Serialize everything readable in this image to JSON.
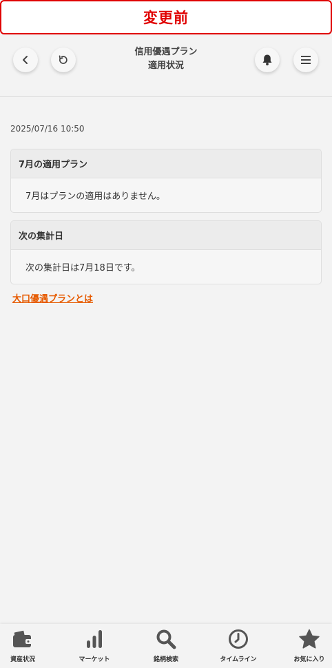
{
  "banner": {
    "text": "変更前"
  },
  "header": {
    "title_line1": "信用優遇プラン",
    "title_line2": "適用状況",
    "back_icon": "chevron-left-icon",
    "refresh_icon": "refresh-icon",
    "bell_icon": "bell-icon",
    "menu_icon": "hamburger-menu-icon"
  },
  "main": {
    "timestamp": "2025/07/16 10:50",
    "plan_card": {
      "title": "7月の適用プラン",
      "body": "7月はプランの適用はありません。"
    },
    "next_card": {
      "title": "次の集計日",
      "body": "次の集計日は7月18日です。"
    },
    "link_text": "大口優遇プランとは"
  },
  "tabbar": {
    "items": [
      {
        "label": "資産状況",
        "icon": "wallet-icon"
      },
      {
        "label": "マーケット",
        "icon": "bar-chart-icon"
      },
      {
        "label": "銘柄検索",
        "icon": "search-icon"
      },
      {
        "label": "タイムライン",
        "icon": "clock-icon"
      },
      {
        "label": "お気に入り",
        "icon": "star-icon"
      }
    ]
  },
  "colors": {
    "banner_red": "#e00000",
    "link_orange": "#e65a00",
    "background": "#f3f3f3",
    "icon_gray": "#555555"
  }
}
